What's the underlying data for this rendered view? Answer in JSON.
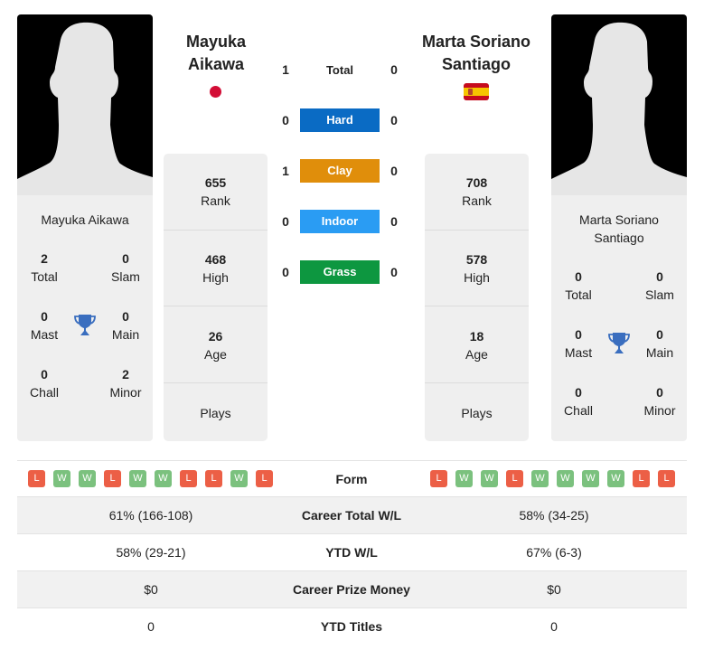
{
  "colors": {
    "hard": "#0a6bc4",
    "clay": "#e08e0b",
    "indoor": "#2a9cf3",
    "grass": "#0d9740",
    "win": "#7bc17e",
    "loss": "#ec5f46",
    "trophy": "#3a6ebf"
  },
  "player_left": {
    "name": "Mayuka Aikawa",
    "header_name": "Mayuka Aikawa",
    "flag": "japan-flag",
    "titles": {
      "total": {
        "value": "2",
        "label": "Total"
      },
      "slam": {
        "value": "0",
        "label": "Slam"
      },
      "mast": {
        "value": "0",
        "label": "Mast"
      },
      "main": {
        "value": "0",
        "label": "Main"
      },
      "chall": {
        "value": "0",
        "label": "Chall"
      },
      "minor": {
        "value": "2",
        "label": "Minor"
      }
    },
    "stats": {
      "rank": {
        "value": "655",
        "label": "Rank"
      },
      "high": {
        "value": "468",
        "label": "High"
      },
      "age": {
        "value": "26",
        "label": "Age"
      },
      "plays": {
        "value": "",
        "label": "Plays"
      }
    },
    "form": [
      "L",
      "W",
      "W",
      "L",
      "W",
      "W",
      "L",
      "L",
      "W",
      "L"
    ]
  },
  "player_right": {
    "name": "Marta Soriano Santiago",
    "header_name": "Marta Soriano Santiago",
    "flag": "spain-flag",
    "titles": {
      "total": {
        "value": "0",
        "label": "Total"
      },
      "slam": {
        "value": "0",
        "label": "Slam"
      },
      "mast": {
        "value": "0",
        "label": "Mast"
      },
      "main": {
        "value": "0",
        "label": "Main"
      },
      "chall": {
        "value": "0",
        "label": "Chall"
      },
      "minor": {
        "value": "0",
        "label": "Minor"
      }
    },
    "stats": {
      "rank": {
        "value": "708",
        "label": "Rank"
      },
      "high": {
        "value": "578",
        "label": "High"
      },
      "age": {
        "value": "18",
        "label": "Age"
      },
      "plays": {
        "value": "",
        "label": "Plays"
      }
    },
    "form": [
      "L",
      "W",
      "W",
      "L",
      "W",
      "W",
      "W",
      "W",
      "L",
      "L"
    ]
  },
  "h2h": [
    {
      "surface": "Total",
      "left": "1",
      "right": "0"
    },
    {
      "surface": "Hard",
      "left": "0",
      "right": "0"
    },
    {
      "surface": "Clay",
      "left": "1",
      "right": "0"
    },
    {
      "surface": "Indoor",
      "left": "0",
      "right": "0"
    },
    {
      "surface": "Grass",
      "left": "0",
      "right": "0"
    }
  ],
  "form_label": "Form",
  "comparison": [
    {
      "label": "Career Total W/L",
      "left": "61% (166-108)",
      "right": "58% (34-25)"
    },
    {
      "label": "YTD W/L",
      "left": "58% (29-21)",
      "right": "67% (6-3)"
    },
    {
      "label": "Career Prize Money",
      "left": "$0",
      "right": "$0"
    },
    {
      "label": "YTD Titles",
      "left": "0",
      "right": "0"
    }
  ]
}
